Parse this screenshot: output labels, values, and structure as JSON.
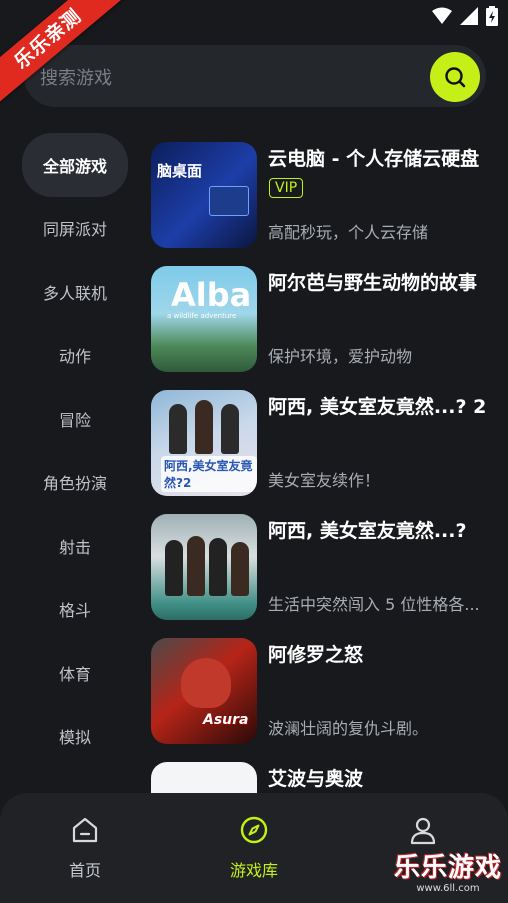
{
  "watermark": {
    "ribbon": "乐乐亲测",
    "logo": "乐乐游戏",
    "url": "www.6ll.com"
  },
  "search": {
    "placeholder": "搜索游戏"
  },
  "categories": [
    {
      "label": "全部游戏",
      "active": true
    },
    {
      "label": "同屏派对"
    },
    {
      "label": "多人联机"
    },
    {
      "label": "动作"
    },
    {
      "label": "冒险"
    },
    {
      "label": "角色扮演"
    },
    {
      "label": "射击"
    },
    {
      "label": "格斗"
    },
    {
      "label": "体育"
    },
    {
      "label": "模拟"
    }
  ],
  "games": [
    {
      "title": "云电脑 - 个人存储云硬盘",
      "badge": "VIP",
      "desc": "高配秒玩，个人云存储",
      "thumb_text": "脑桌面"
    },
    {
      "title": "阿尔芭与野生动物的故事",
      "desc": "保护环境，爱护动物",
      "thumb_text": "Alba",
      "thumb_sub": "a wildlife adventure"
    },
    {
      "title": "阿西, 美女室友竟然...? 2",
      "desc": "美女室友续作！",
      "thumb_text": "阿西,美女室友竟然?2"
    },
    {
      "title": "阿西, 美女室友竟然...?",
      "desc": "生活中突然闯入 5 位性格各...",
      "thumb_text": ""
    },
    {
      "title": "阿修罗之怒",
      "desc": "波澜壮阔的复仇斗剧。",
      "thumb_text": "Asura"
    },
    {
      "title": "艾波与奥波",
      "desc": "",
      "thumb_text": ""
    }
  ],
  "nav": [
    {
      "label": "首页",
      "icon": "home-icon"
    },
    {
      "label": "游戏库",
      "icon": "compass-icon",
      "active": true
    },
    {
      "label": "",
      "icon": "profile-icon"
    }
  ],
  "colors": {
    "accent": "#c5f017",
    "background": "#17191d"
  }
}
